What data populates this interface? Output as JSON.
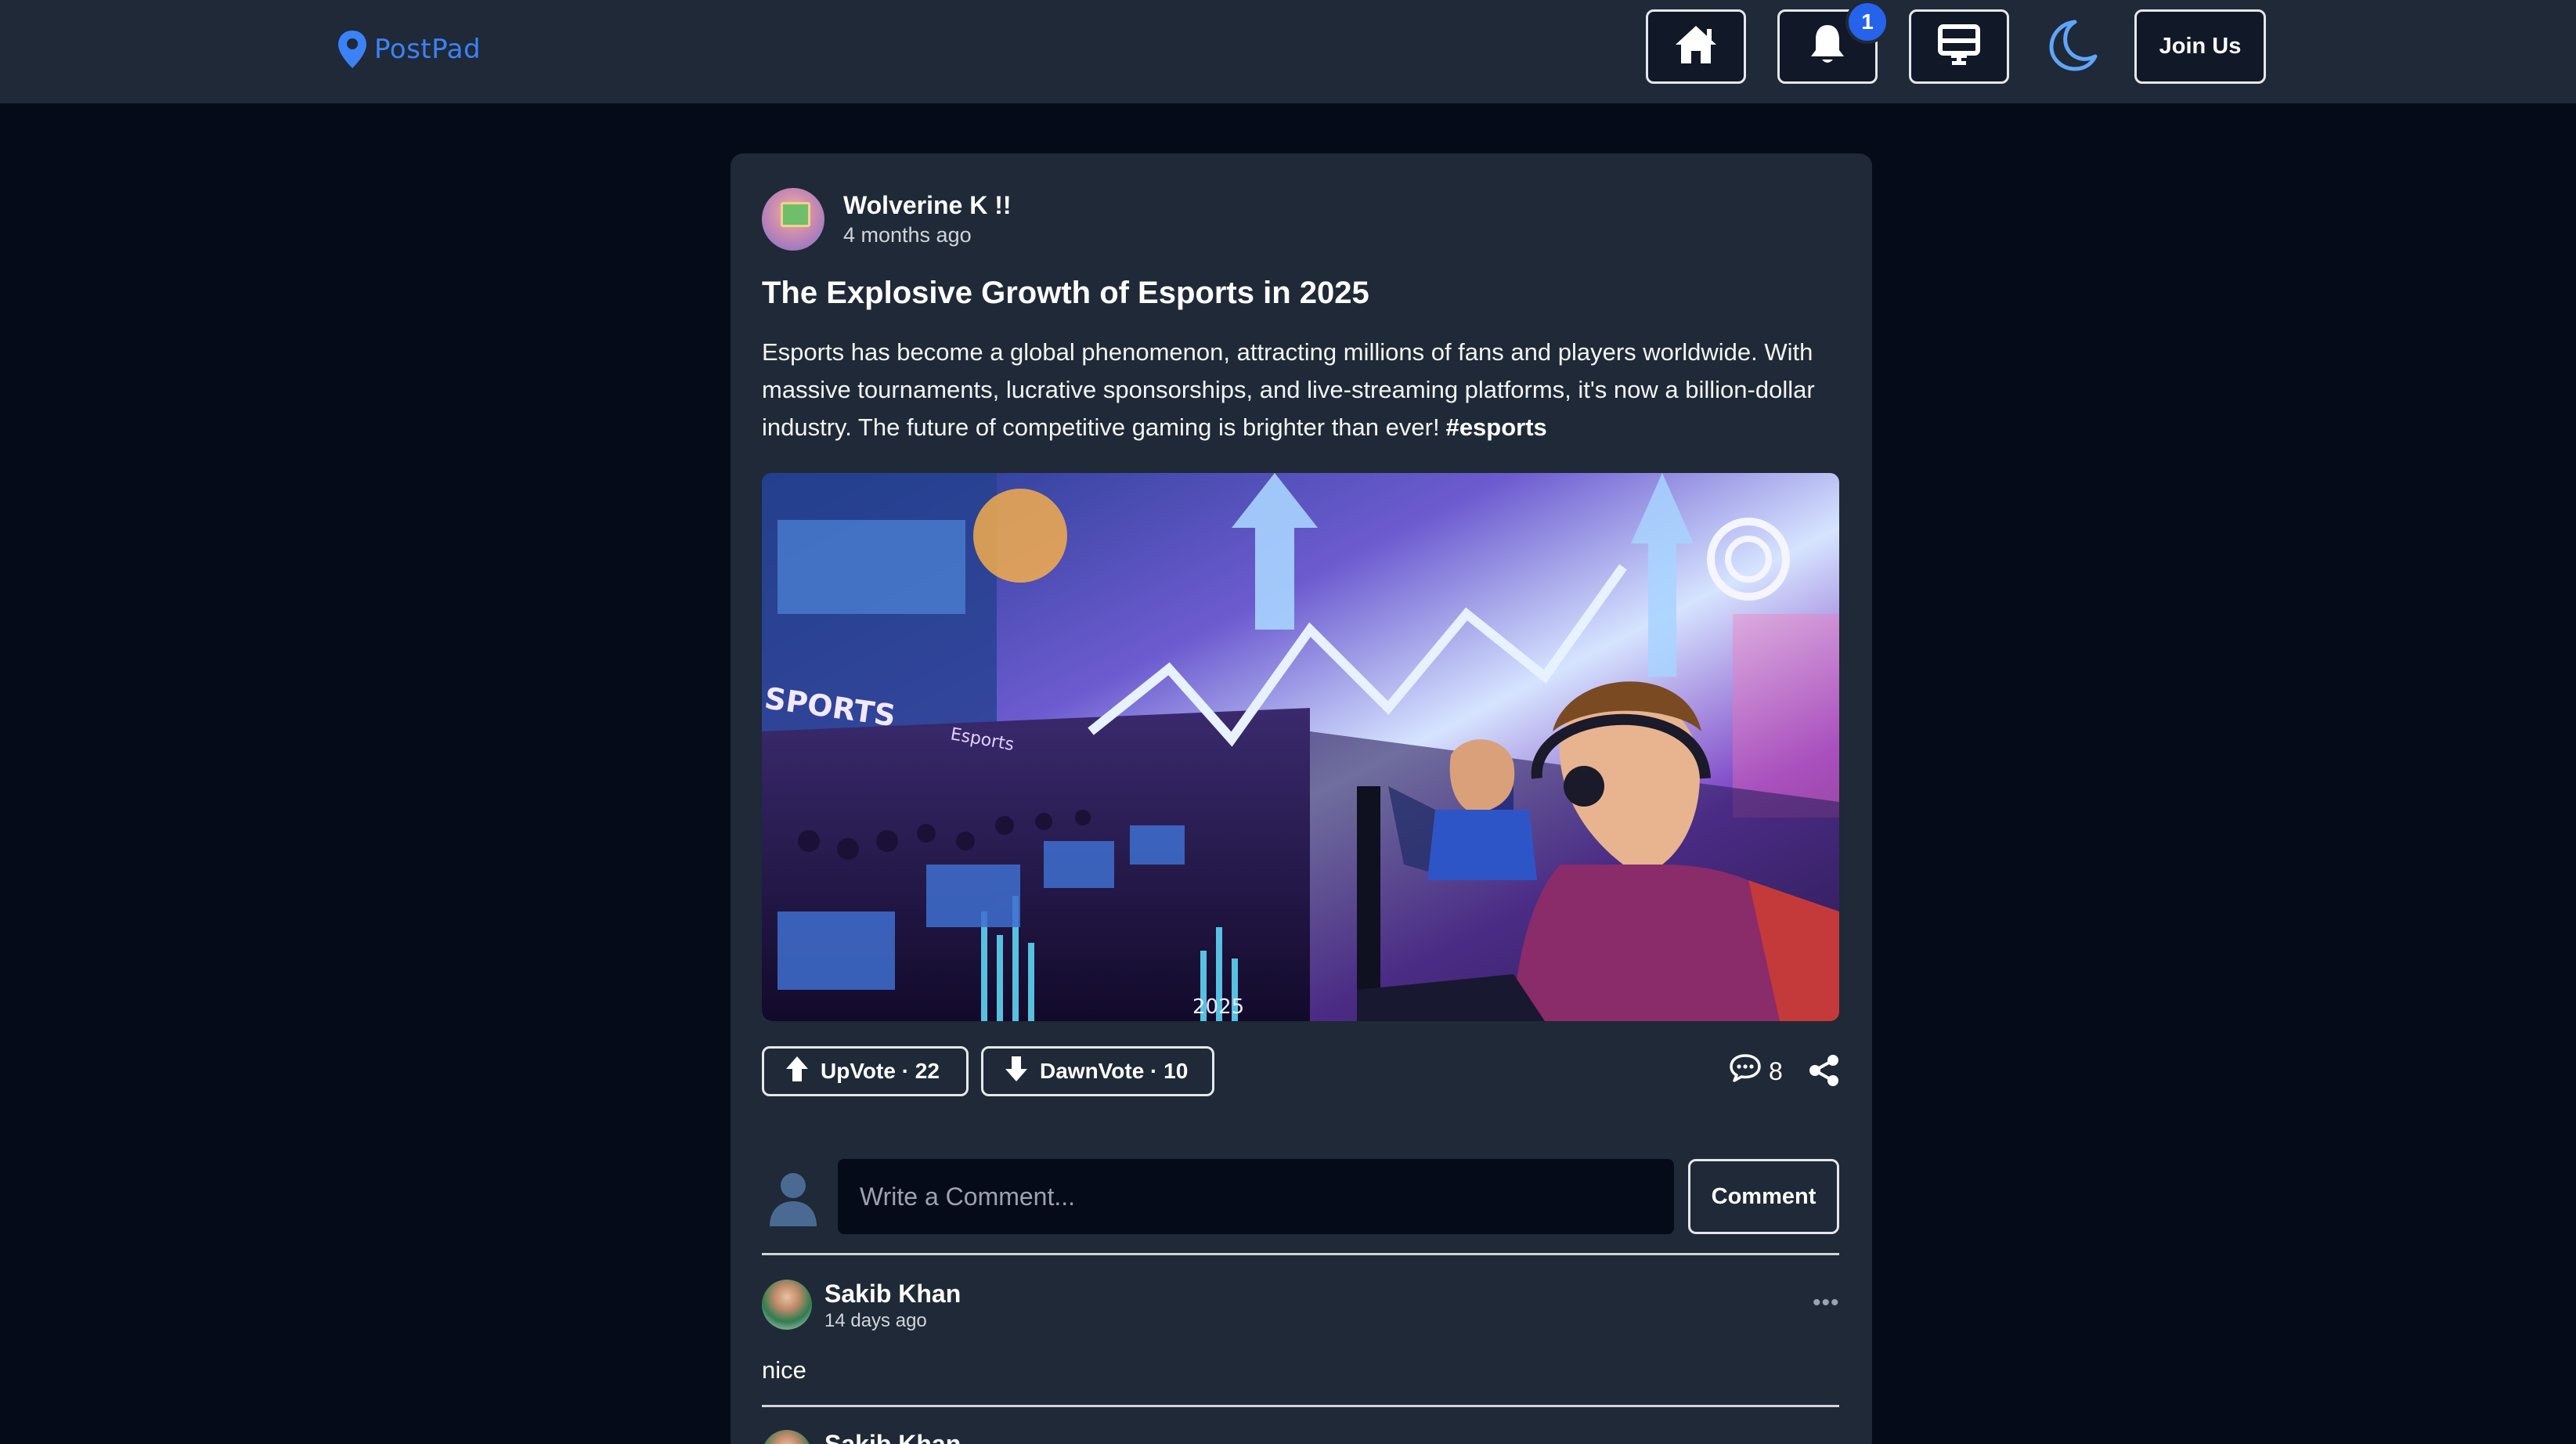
{
  "navbar": {
    "brand": "PostPad",
    "notification_count": "1",
    "join_label": "Join Us",
    "icons": [
      "home-icon",
      "bell-icon",
      "dashboard-icon",
      "moon-icon"
    ]
  },
  "post": {
    "author": {
      "name": "Wolverine K !!",
      "time": "4 months ago"
    },
    "title": "The Explosive Growth of Esports in 2025",
    "body": "Esports has become a global phenomenon, attracting millions of fans and players worldwide. With massive tournaments, lucrative sponsorships, and live-streaming platforms, it's now a billion-dollar industry. The future of competitive gaming is brighter than ever!",
    "hashtag": "#esports",
    "image_texts": [
      "SPORTS",
      "Esports",
      "2025"
    ],
    "upvote_label": "UpVote · 22",
    "downvote_label": "DawnVote · 10",
    "comment_count": "8"
  },
  "comment_form": {
    "placeholder": "Write a Comment...",
    "button_label": "Comment"
  },
  "comments": [
    {
      "name": "Sakib Khan",
      "time": "14 days ago",
      "text": "nice"
    },
    {
      "name": "Sakib Khan"
    }
  ],
  "colors": {
    "page_bg": "#060b1a",
    "surface": "#1f2937",
    "accent": "#3b82f6",
    "badge": "#2563eb",
    "moon": "#60a5fa"
  }
}
